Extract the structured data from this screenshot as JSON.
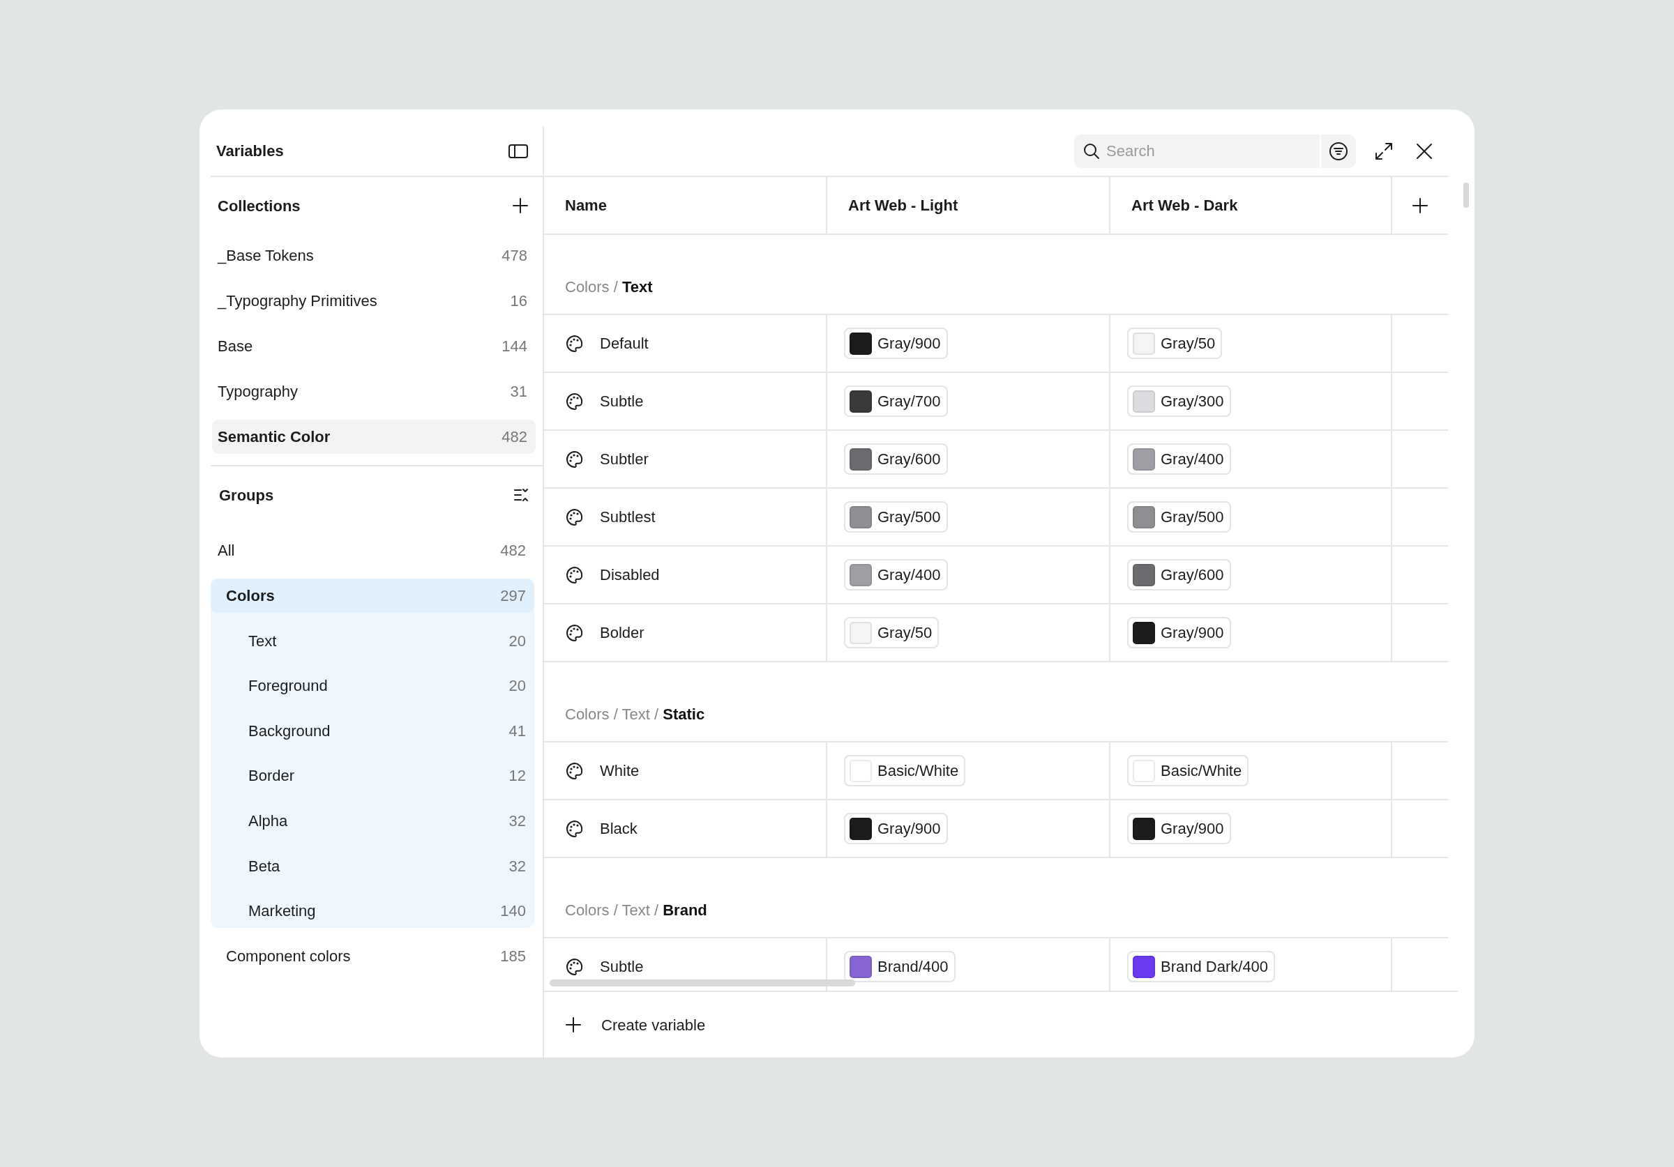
{
  "window": {
    "title": "Variables"
  },
  "collections": {
    "title": "Collections",
    "items": [
      {
        "label": "_Base Tokens",
        "count": "478",
        "selected": false
      },
      {
        "label": "_Typography Primitives",
        "count": "16",
        "selected": false
      },
      {
        "label": "Base",
        "count": "144",
        "selected": false
      },
      {
        "label": "Typography",
        "count": "31",
        "selected": false
      },
      {
        "label": "Semantic Color",
        "count": "482",
        "selected": true
      }
    ]
  },
  "groups": {
    "title": "Groups",
    "all": {
      "label": "All",
      "count": "482"
    },
    "items": [
      {
        "label": "Colors",
        "count": "297",
        "selected": true,
        "children": [
          {
            "label": "Text",
            "count": "20",
            "selected": false
          },
          {
            "label": "Foreground",
            "count": "20",
            "selected": false
          },
          {
            "label": "Background",
            "count": "41",
            "selected": false
          },
          {
            "label": "Border",
            "count": "12",
            "selected": false
          },
          {
            "label": "Alpha",
            "count": "32",
            "selected": false
          },
          {
            "label": "Beta",
            "count": "32",
            "selected": false
          },
          {
            "label": "Marketing",
            "count": "140",
            "selected": false
          }
        ]
      },
      {
        "label": "Component colors",
        "count": "185",
        "selected": false
      }
    ]
  },
  "search": {
    "placeholder": "Search"
  },
  "table": {
    "columns": [
      "Name",
      "Art Web - Light",
      "Art Web - Dark"
    ],
    "sections": [
      {
        "path": "Colors / **Text**",
        "rows": [
          {
            "name": "Default",
            "values": [
              {
                "label": "Gray/900",
                "color": "#1c1c1e"
              },
              {
                "label": "Gray/50",
                "color": "#f4f4f5"
              }
            ]
          },
          {
            "name": "Subtle",
            "values": [
              {
                "label": "Gray/700",
                "color": "#3a3a3c"
              },
              {
                "label": "Gray/300",
                "color": "#dcdce0"
              }
            ]
          },
          {
            "name": "Subtler",
            "values": [
              {
                "label": "Gray/600",
                "color": "#6c6c70"
              },
              {
                "label": "Gray/400",
                "color": "#9e9ea4"
              }
            ]
          },
          {
            "name": "Subtlest",
            "values": [
              {
                "label": "Gray/500",
                "color": "#8e8e93"
              },
              {
                "label": "Gray/500",
                "color": "#8e8e93"
              }
            ]
          },
          {
            "name": "Disabled",
            "values": [
              {
                "label": "Gray/400",
                "color": "#9e9ea4"
              },
              {
                "label": "Gray/600",
                "color": "#6c6c70"
              }
            ]
          },
          {
            "name": "Bolder",
            "values": [
              {
                "label": "Gray/50",
                "color": "#f4f4f5"
              },
              {
                "label": "Gray/900",
                "color": "#1c1c1e"
              }
            ]
          }
        ]
      },
      {
        "path": "Colors / Text / **Static**",
        "rows": [
          {
            "name": "White",
            "values": [
              {
                "label": "Basic/White",
                "color": "#ffffff"
              },
              {
                "label": "Basic/White",
                "color": "#ffffff"
              }
            ]
          },
          {
            "name": "Black",
            "values": [
              {
                "label": "Gray/900",
                "color": "#1c1c1e"
              },
              {
                "label": "Gray/900",
                "color": "#1c1c1e"
              }
            ]
          }
        ]
      },
      {
        "path": "Colors / Text / **Brand**",
        "rows": [
          {
            "name": "Subtle",
            "values": [
              {
                "label": "Brand/400",
                "color": "#8763d3"
              },
              {
                "label": "Brand Dark/400",
                "color": "#6b3bf0"
              }
            ]
          }
        ]
      }
    ]
  },
  "footer": {
    "create_label": "Create variable"
  }
}
